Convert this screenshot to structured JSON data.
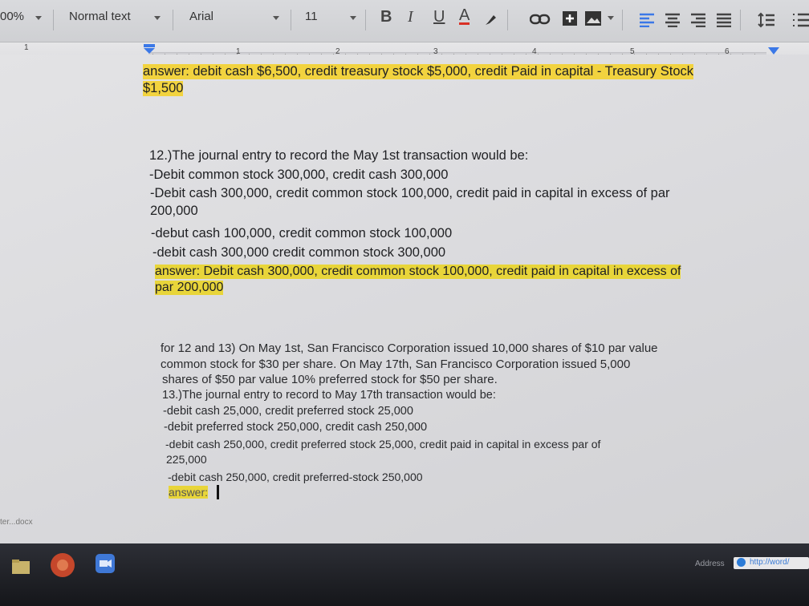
{
  "toolbar": {
    "zoom": "00%",
    "style": "Normal text",
    "font": "Arial",
    "size": "11",
    "bold": "B",
    "italic": "I",
    "underline": "U",
    "text_color": "A"
  },
  "ruler": {
    "left_number": "1",
    "numbers": [
      "1",
      "2",
      "3",
      "4",
      "5",
      "6"
    ]
  },
  "document": {
    "prev_answer_line1": "answer: debit cash $6,500, credit treasury stock $5,000, credit Paid in capital - Treasury Stock",
    "prev_answer_line2": "$1,500",
    "q12": {
      "question": "12.)The journal entry to record the May 1st transaction would be:",
      "options": [
        "-Debit common stock 300,000, credit cash 300,000",
        "-Debit cash 300,000, credit common stock 100,000, credit paid in capital in excess of par",
        "200,000",
        "-debut cash 100,000, credit common stock 100,000",
        "-debit cash 300,000 credit common stock 300,000"
      ],
      "answer_line1": "answer: Debit cash 300,000, credit common stock 100,000, credit paid in capital in excess of",
      "answer_line2": "par 200,000"
    },
    "context": [
      "for 12 and 13) On May 1st, San Francisco Corporation issued 10,000 shares of $10 par value",
      "common stock for $30 per share.  On May 17th, San Francisco Corporation issued 5,000",
      "shares of $50 par value 10% preferred stock for $50 per share."
    ],
    "q13": {
      "question": "13.)The journal entry to record to May 17th transaction would be:",
      "options": [
        "-debit cash 25,000,  credit preferred stock 25,000",
        "-debit preferred stock 250,000, credit cash 250,000",
        "-debit cash 250,000, credit preferred stock 25,000, credit paid in capital in excess par of",
        "225,000",
        "-debit cash 250,000, credit preferred-stock 250,000"
      ],
      "answer": "answer:"
    }
  },
  "bottom_tab_label": "ter...docx",
  "taskbar": {
    "address_label": "Address",
    "address_value": "http://word/"
  },
  "colors": {
    "highlight": "#f2d33f",
    "accent_blue": "#3b78e7"
  }
}
